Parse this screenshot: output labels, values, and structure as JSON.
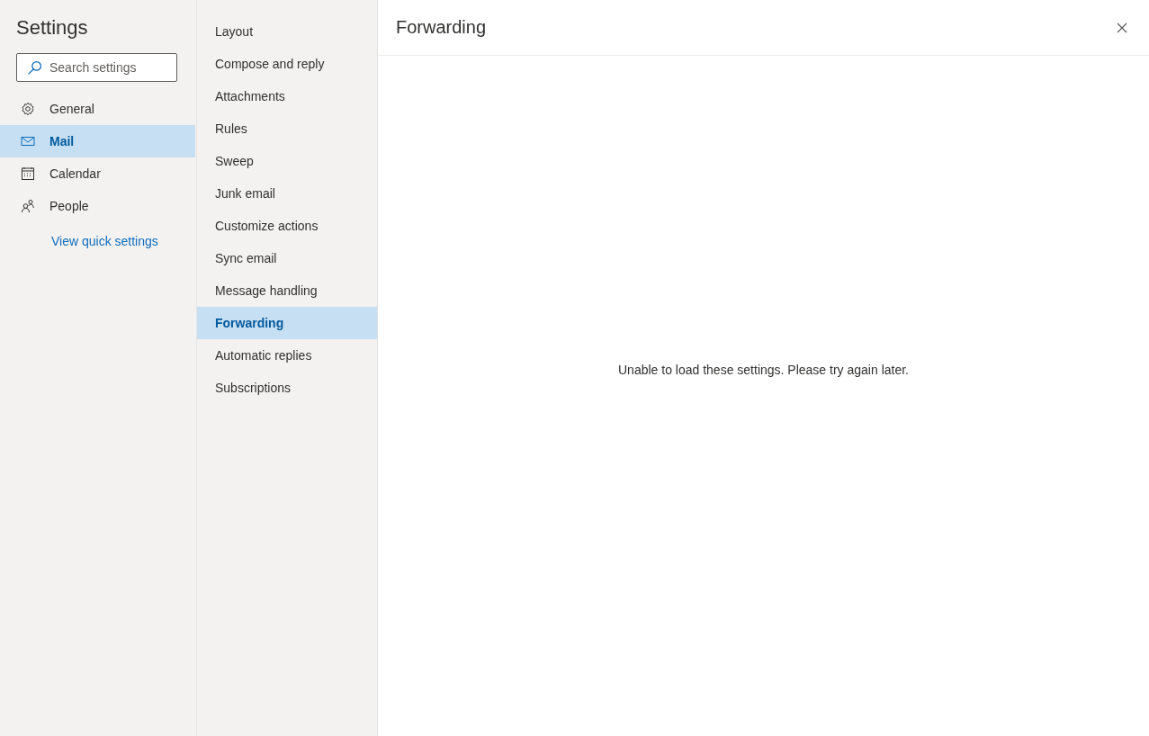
{
  "sidebar": {
    "title": "Settings",
    "search": {
      "placeholder": "Search settings"
    },
    "items": [
      {
        "label": "General",
        "kind": "gear",
        "selected": false
      },
      {
        "label": "Mail",
        "kind": "mail",
        "selected": true
      },
      {
        "label": "Calendar",
        "kind": "calendar",
        "selected": false
      },
      {
        "label": "People",
        "kind": "people",
        "selected": false
      }
    ],
    "link": "View quick settings"
  },
  "subnav": {
    "items": [
      {
        "label": "Layout",
        "selected": false
      },
      {
        "label": "Compose and reply",
        "selected": false
      },
      {
        "label": "Attachments",
        "selected": false
      },
      {
        "label": "Rules",
        "selected": false
      },
      {
        "label": "Sweep",
        "selected": false
      },
      {
        "label": "Junk email",
        "selected": false
      },
      {
        "label": "Customize actions",
        "selected": false
      },
      {
        "label": "Sync email",
        "selected": false
      },
      {
        "label": "Message handling",
        "selected": false
      },
      {
        "label": "Forwarding",
        "selected": true
      },
      {
        "label": "Automatic replies",
        "selected": false
      },
      {
        "label": "Subscriptions",
        "selected": false
      }
    ]
  },
  "content": {
    "title": "Forwarding",
    "message": "Unable to load these settings. Please try again later."
  }
}
